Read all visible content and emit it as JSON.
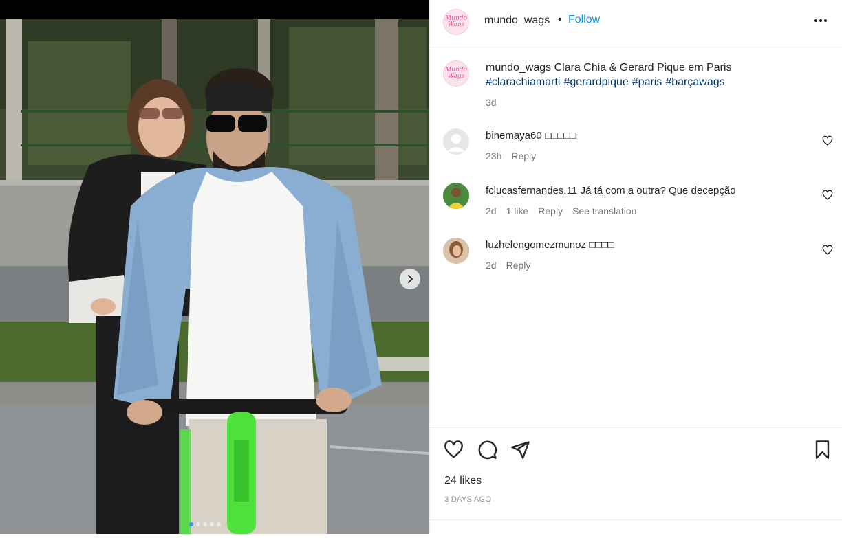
{
  "post": {
    "author": "mundo_wags",
    "follow_label": "Follow",
    "separator": "•",
    "more_label": "•••",
    "logo_lines": [
      "Mundo",
      "Wags"
    ]
  },
  "caption": {
    "author": "mundo_wags",
    "text": "Clara Chia & Gerard Pique em Paris",
    "hashtags": [
      "#clarachiamarti",
      "#gerardpique",
      "#paris",
      "#barçawags"
    ],
    "time": "3d"
  },
  "comments": [
    {
      "user": "binemaya60",
      "text": "□□□□□",
      "time": "23h",
      "likes": "",
      "reply": "Reply",
      "translate": ""
    },
    {
      "user": "fclucasfernandes.11",
      "text": "Já tá com a outra? Que decepção",
      "time": "2d",
      "likes": "1 like",
      "reply": "Reply",
      "translate": "See translation"
    },
    {
      "user": "luzhelengomezmunoz",
      "text": "□□□□",
      "time": "2d",
      "likes": "",
      "reply": "Reply",
      "translate": ""
    }
  ],
  "footer": {
    "likes": "24 likes",
    "time_ago": "3 DAYS AGO"
  },
  "icons": {
    "like": "heart-icon",
    "comment": "comment-icon",
    "share": "share-icon",
    "save": "bookmark-icon",
    "next": "chevron-right-icon",
    "more": "more-icon"
  },
  "colors": {
    "accent": "#0095f6",
    "hashtag": "#00376b",
    "muted": "#737373",
    "scooter": "#4ee03c"
  }
}
